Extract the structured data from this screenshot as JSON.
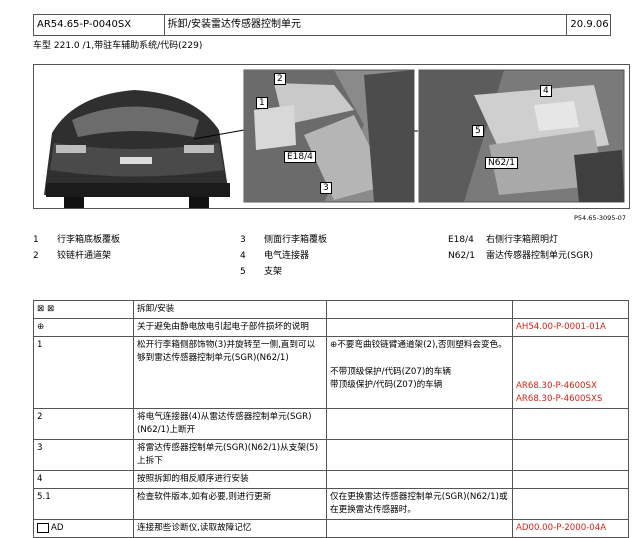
{
  "header": {
    "doc_id": "AR54.65-P-0040SX",
    "title": "拆卸/安装雷达传感器控制单元",
    "date": "20.9.06"
  },
  "vehicle_line": "车型   221.0 /1,带驻车辅助系统/代码(229)",
  "figure": {
    "ref": "P54.65-3095-07",
    "callouts_center": [
      "1",
      "2",
      "E18/4",
      "3"
    ],
    "callouts_right": [
      "4",
      "5",
      "N62/1"
    ]
  },
  "legend": {
    "col1": [
      {
        "num": "1",
        "text": "行李箱底板覆板"
      },
      {
        "num": "2",
        "text": "铰链杆通道架"
      }
    ],
    "col2": [
      {
        "num": "3",
        "text": "侧面行李箱覆板"
      },
      {
        "num": "4",
        "text": "电气连接器"
      },
      {
        "num": "5",
        "text": "支架"
      }
    ],
    "col3": [
      {
        "num": "E18/4",
        "text": "右侧行李箱照明灯"
      },
      {
        "num": "N62/1",
        "text": "雷达传感器控制单元(SGR)"
      }
    ]
  },
  "table": {
    "header_label": "拆卸/安装",
    "rows": [
      {
        "step": "⊕",
        "text": "关于避免由静电放电引起电子部件损坏的说明",
        "note": "",
        "ref": "AH54.00-P-0001-01A"
      },
      {
        "step": "1",
        "text": "松开行李箱侧部饰物(3)并旋转至一侧,直到可以够到雷达传感器控制单元(SGR)(N62/1)",
        "note_top": "⊕不要弯曲铰链臂通道架(2),否则塑料会变色。",
        "note_a": "不带顶级保护/代码(Z07)的车辆",
        "ref_a": "AR68.30-P-4600SX",
        "note_b": "带顶级保护/代码(Z07)的车辆",
        "ref_b": "AR68.30-P-4600SXS"
      },
      {
        "step": "2",
        "text": "将电气连接器(4)从雷达传感器控制单元(SGR)(N62/1)上断开",
        "note": "",
        "ref": ""
      },
      {
        "step": "3",
        "text": "将雷达传感器控制单元(SGR)(N62/1)从支架(5)上拆下",
        "note": "",
        "ref": ""
      },
      {
        "step": "4",
        "text": "按照拆卸的相反顺序进行安装",
        "note": "",
        "ref": ""
      },
      {
        "step": "5.1",
        "text": "检查软件版本,如有必要,则进行更新",
        "note": "仅在更换雷达传感器控制单元(SGR)(N62/1)或在更换雷达传感器时。",
        "ref": ""
      },
      {
        "step": "AD",
        "text": "连接那些诊断仪,读取故障记忆",
        "note": "",
        "ref": "AD00.00-P-2000-04A"
      }
    ]
  },
  "colors": {
    "accent_red": "#d4231a"
  }
}
